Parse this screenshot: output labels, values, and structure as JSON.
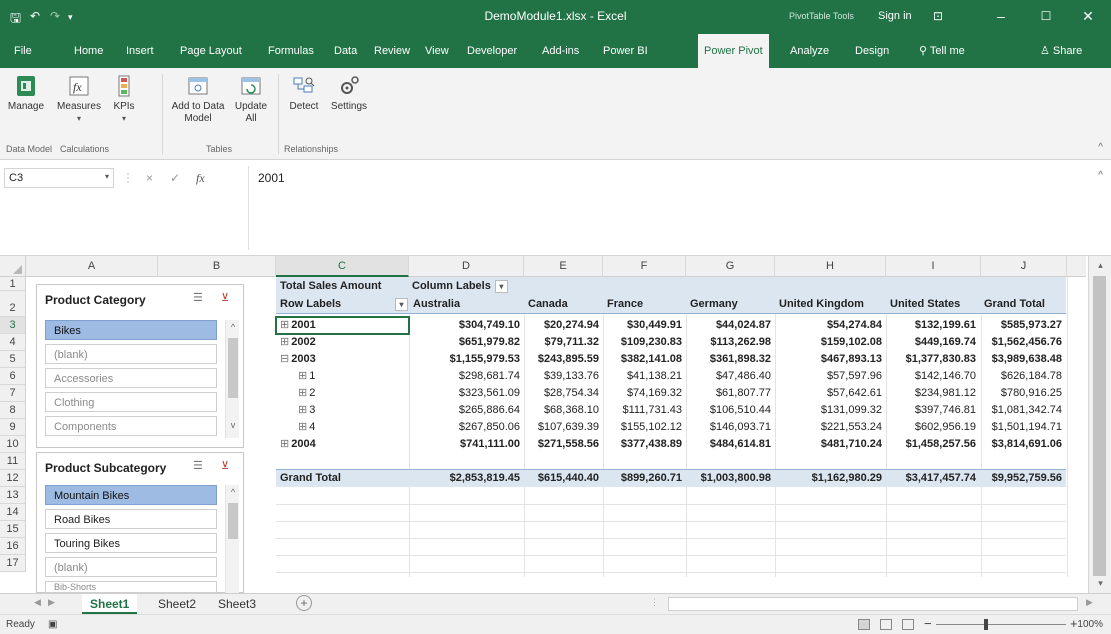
{
  "title_bar": {
    "file_title": "DemoModule1.xlsx - Excel",
    "contextual_group": "PivotTable Tools",
    "sign_in": "Sign in",
    "icons": [
      "save-icon",
      "undo-icon",
      "redo-icon",
      "customize-qat-icon",
      "ribbon-display-icon",
      "minimize-icon",
      "maximize-icon",
      "close-icon"
    ]
  },
  "menu": {
    "tabs": [
      "File",
      "Home",
      "Insert",
      "Page Layout",
      "Formulas",
      "Data",
      "Review",
      "View",
      "Developer",
      "Add-ins",
      "Power BI",
      "Power Pivot",
      "Analyze",
      "Design"
    ],
    "active_tab": "Power Pivot",
    "tell_me": "Tell me",
    "share": "Share"
  },
  "ribbon": {
    "buttons": [
      {
        "label": "Manage",
        "icon": "manage-data-model-icon"
      },
      {
        "label": "Measures",
        "icon": "measures-fx-icon",
        "dropdown": "▾"
      },
      {
        "label": "KPIs",
        "icon": "kpi-icon",
        "dropdown": "▾"
      },
      {
        "label": "Add to Data Model",
        "icon": "add-to-data-model-icon"
      },
      {
        "label": "Update All",
        "icon": "update-all-icon"
      },
      {
        "label": "Detect",
        "icon": "detect-relationships-icon"
      },
      {
        "label": "Settings",
        "icon": "settings-gear-icon"
      }
    ],
    "groups": [
      "Data Model",
      "Calculations",
      "Tables",
      "Relationships"
    ],
    "collapse": "^"
  },
  "formula_bar": {
    "name_box": "C3",
    "cancel": "×",
    "enter": "✓",
    "fx": "fx",
    "value": "2001",
    "expand": "^"
  },
  "grid": {
    "columns": [
      "A",
      "B",
      "C",
      "D",
      "E",
      "F",
      "G",
      "H",
      "I",
      "J"
    ],
    "rows": [
      "1",
      "2",
      "3",
      "4",
      "5",
      "6",
      "7",
      "8",
      "9",
      "10",
      "11",
      "12",
      "13",
      "14",
      "15",
      "16",
      "17"
    ],
    "selected_column": "C",
    "selected_row": "3"
  },
  "slicers": [
    {
      "header": "Product Category",
      "items": [
        {
          "label": "Bikes",
          "state": "selected"
        },
        {
          "label": "(blank)",
          "state": "dim"
        },
        {
          "label": "Accessories",
          "state": "dim"
        },
        {
          "label": "Clothing",
          "state": "dim"
        },
        {
          "label": "Components",
          "state": "dim"
        }
      ]
    },
    {
      "header": "Product Subcategory",
      "items": [
        {
          "label": "Mountain Bikes",
          "state": "selected"
        },
        {
          "label": "Road Bikes",
          "state": "normal"
        },
        {
          "label": "Touring Bikes",
          "state": "normal"
        },
        {
          "label": "(blank)",
          "state": "dim"
        },
        {
          "label": "Bib-Shorts",
          "state": "dim"
        }
      ]
    }
  ],
  "pivot": {
    "measure": "Total Sales Amount",
    "column_labels": "Column Labels",
    "row_labels": "Row Labels",
    "filter_icon": "▾",
    "columns": [
      "Australia",
      "Canada",
      "France",
      "Germany",
      "United Kingdom",
      "United States",
      "Grand Total"
    ],
    "rows": [
      {
        "label": "2001",
        "expander": "⊞",
        "bold": true,
        "level": 0,
        "values": [
          "$304,749.10",
          "$20,274.94",
          "$30,449.91",
          "$44,024.87",
          "$54,274.84",
          "$132,199.61",
          "$585,973.27"
        ]
      },
      {
        "label": "2002",
        "expander": "⊞",
        "bold": true,
        "level": 0,
        "values": [
          "$651,979.82",
          "$79,711.32",
          "$109,230.83",
          "$113,262.98",
          "$159,102.08",
          "$449,169.74",
          "$1,562,456.76"
        ]
      },
      {
        "label": "2003",
        "expander": "⊟",
        "bold": true,
        "level": 0,
        "values": [
          "$1,155,979.53",
          "$243,895.59",
          "$382,141.08",
          "$361,898.32",
          "$467,893.13",
          "$1,377,830.83",
          "$3,989,638.48"
        ]
      },
      {
        "label": "1",
        "expander": "⊞",
        "bold": false,
        "level": 1,
        "values": [
          "$298,681.74",
          "$39,133.76",
          "$41,138.21",
          "$47,486.40",
          "$57,597.96",
          "$142,146.70",
          "$626,184.78"
        ]
      },
      {
        "label": "2",
        "expander": "⊞",
        "bold": false,
        "level": 1,
        "values": [
          "$323,561.09",
          "$28,754.34",
          "$74,169.32",
          "$61,807.77",
          "$57,642.61",
          "$234,981.12",
          "$780,916.25"
        ]
      },
      {
        "label": "3",
        "expander": "⊞",
        "bold": false,
        "level": 1,
        "values": [
          "$265,886.64",
          "$68,368.10",
          "$111,731.43",
          "$106,510.44",
          "$131,099.32",
          "$397,746.81",
          "$1,081,342.74"
        ]
      },
      {
        "label": "4",
        "expander": "⊞",
        "bold": false,
        "level": 1,
        "values": [
          "$267,850.06",
          "$107,639.39",
          "$155,102.12",
          "$146,093.71",
          "$221,553.24",
          "$602,956.19",
          "$1,501,194.71"
        ]
      },
      {
        "label": "2004",
        "expander": "⊞",
        "bold": true,
        "level": 0,
        "values": [
          "$741,111.00",
          "$271,558.56",
          "$377,438.89",
          "$484,614.81",
          "$481,710.24",
          "$1,458,257.56",
          "$3,814,691.06"
        ]
      }
    ],
    "grand_total": {
      "label": "Grand Total",
      "values": [
        "$2,853,819.45",
        "$615,440.40",
        "$899,260.71",
        "$1,003,800.98",
        "$1,162,980.29",
        "$3,417,457.74",
        "$9,952,759.56"
      ]
    }
  },
  "sheets": {
    "tabs": [
      "Sheet1",
      "Sheet2",
      "Sheet3"
    ],
    "active": "Sheet1",
    "add": "+"
  },
  "status": {
    "ready": "Ready",
    "zoom": "100%"
  },
  "colors": {
    "excel_green": "#217346",
    "pivot_header": "#dce6f1",
    "slicer_selected": "#9dbbe3"
  }
}
